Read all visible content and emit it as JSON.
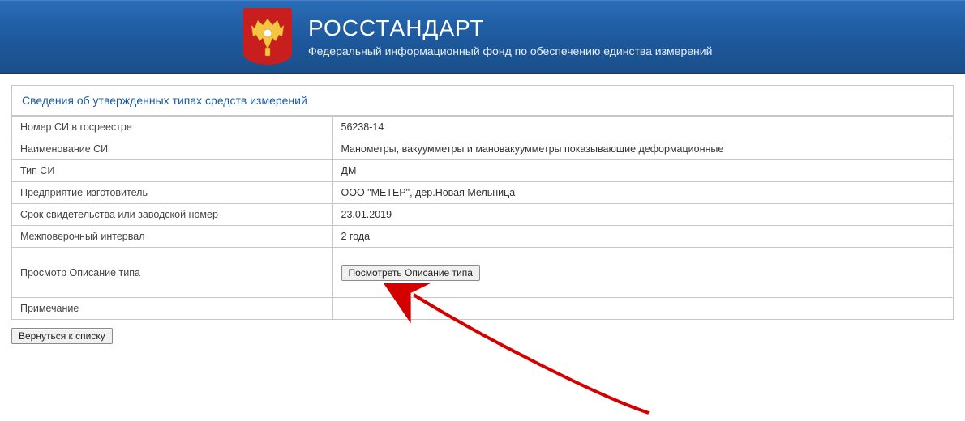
{
  "header": {
    "title": "РОССТАНДАРТ",
    "subtitle": "Федеральный информационный фонд по обеспечению единства измерений"
  },
  "panel": {
    "title": "Сведения об утвержденных типах средств измерений"
  },
  "rows": {
    "reg_number_label": "Номер СИ в госреестре",
    "reg_number_value": "56238-14",
    "name_label": "Наименование СИ",
    "name_value": "Манометры, вакуумметры и мановакуумметры показывающие деформационные",
    "type_label": "Тип СИ",
    "type_value": "ДМ",
    "manufacturer_label": "Предприятие-изготовитель",
    "manufacturer_value": "ООО \"МЕТЕР\", дер.Новая Мельница",
    "cert_label": "Срок свидетельства или заводской номер",
    "cert_value": "23.01.2019",
    "interval_label": "Межповерочный интервал",
    "interval_value": "2 года",
    "view_desc_label": "Просмотр Описание типа",
    "note_label": "Примечание",
    "note_value": ""
  },
  "buttons": {
    "view_description": "Посмотреть Описание типа",
    "back_to_list": "Вернуться к списку"
  }
}
